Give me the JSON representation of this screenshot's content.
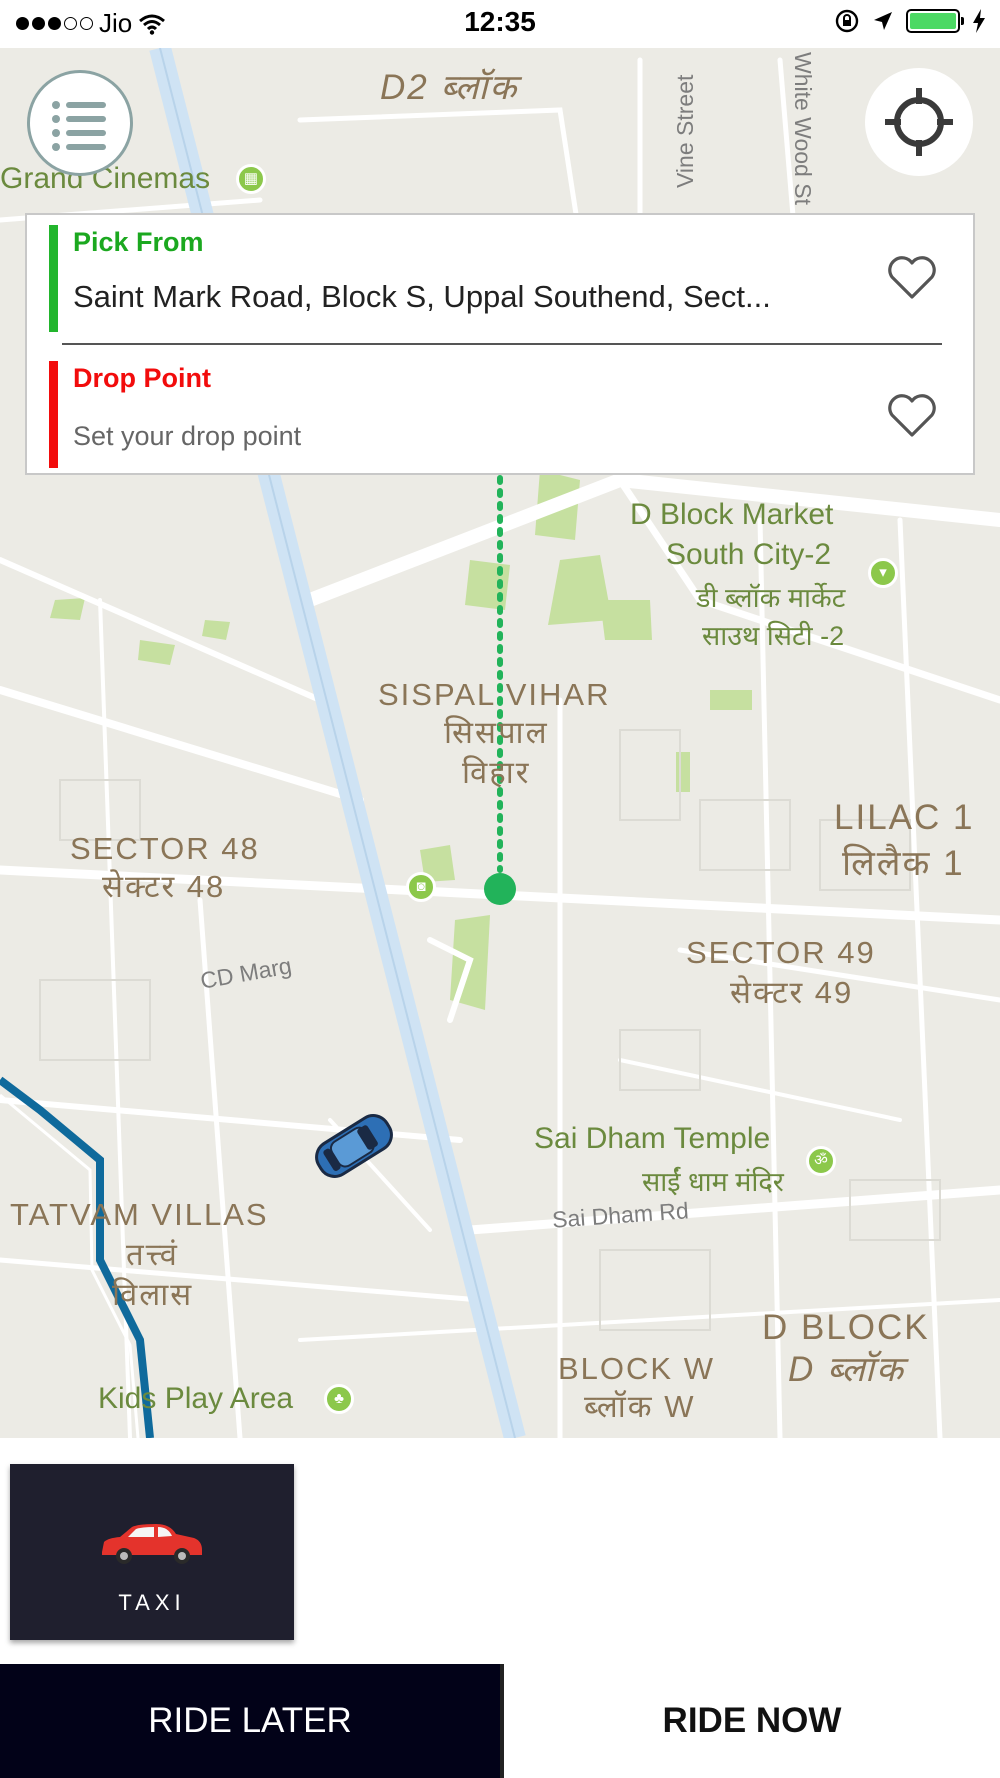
{
  "status_bar": {
    "carrier": "Jio",
    "time": "12:35",
    "signal_bars_filled": 3,
    "signal_bars_total": 5,
    "battery_level": 1.0
  },
  "map": {
    "area_labels": [
      {
        "name": "d2-block",
        "text": "D2 ब्लॉक"
      },
      {
        "name": "sispal-vihar",
        "text": "SISPAL VIHAR"
      },
      {
        "name": "sispal-vihar-hi-1",
        "text": "सिसपाल"
      },
      {
        "name": "sispal-vihar-hi-2",
        "text": "विहार"
      },
      {
        "name": "sector-48",
        "text": "SECTOR 48"
      },
      {
        "name": "sector-48-hi",
        "text": "सेक्टर 48"
      },
      {
        "name": "lilac-1",
        "text": "LILAC 1"
      },
      {
        "name": "lilac-1-hi",
        "text": "लिलैक 1"
      },
      {
        "name": "sector-49",
        "text": "SECTOR 49"
      },
      {
        "name": "sector-49-hi",
        "text": "सेक्टर 49"
      },
      {
        "name": "tatvam-villas",
        "text": "TATVAM VILLAS"
      },
      {
        "name": "tatvam-villas-hi-1",
        "text": "तत्त्वं"
      },
      {
        "name": "tatvam-villas-hi-2",
        "text": "विलास"
      },
      {
        "name": "block-w",
        "text": "BLOCK W"
      },
      {
        "name": "block-w-hi",
        "text": "ब्लॉक W"
      },
      {
        "name": "d-block",
        "text": "D BLOCK"
      },
      {
        "name": "d-block-hi",
        "text": "D ब्लॉक"
      }
    ],
    "poi_labels": [
      {
        "name": "grand-cinemas",
        "text": "Grand Cinemas"
      },
      {
        "name": "d-block-market",
        "text": "D Block Market"
      },
      {
        "name": "south-city-2",
        "text": "South City-2"
      },
      {
        "name": "d-block-market-hi",
        "text": "डी ब्लॉक मार्केट"
      },
      {
        "name": "south-city-2-hi",
        "text": "साउथ सिटी -2"
      },
      {
        "name": "sai-dham-temple",
        "text": "Sai Dham Temple"
      },
      {
        "name": "sai-dham-temple-hi",
        "text": "साईं धाम मंदिर"
      },
      {
        "name": "kids-play-area",
        "text": "Kids Play Area"
      }
    ],
    "street_labels": [
      {
        "name": "vine-street",
        "text": "Vine Street"
      },
      {
        "name": "white-wood-st",
        "text": "White Wood St"
      },
      {
        "name": "cd-marg",
        "text": "CD Marg"
      },
      {
        "name": "sai-dham-rd",
        "text": "Sai Dham Rd"
      }
    ],
    "colors": {
      "background": "#ecebe5",
      "park": "#c6e0a0",
      "highway": "#cfe3f4",
      "route_dots": "#22b35a",
      "transit_line": "#0f6a9c"
    }
  },
  "location_card": {
    "pick_label": "Pick From",
    "pick_value": "Saint Mark Road, Block S, Uppal Southend, Sect...",
    "drop_label": "Drop Point",
    "drop_placeholder": "Set your drop point",
    "colors": {
      "pick": "#1ba81f",
      "drop": "#f20c0c"
    }
  },
  "vehicle_types": [
    {
      "label": "TAXI",
      "selected": true
    }
  ],
  "actions": {
    "ride_later": "RIDE LATER",
    "ride_now": "RIDE NOW"
  }
}
